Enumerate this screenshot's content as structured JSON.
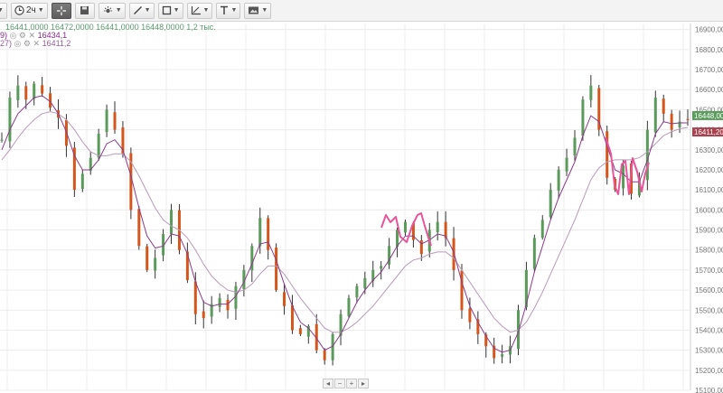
{
  "toolbar": {
    "interval_label": "2ч",
    "tools": [
      "menu",
      "interval",
      "crosshair",
      "save",
      "indicators",
      "draw-line",
      "draw-shape",
      "fibonacci",
      "text",
      "chart-type"
    ]
  },
  "legend": {
    "ohlc_text": "16441,0000   16472,0000   16441,0000   16448,0000   1,2 тыс.",
    "ma1_prefix": "9)",
    "ma1_value": "16434,1",
    "ma2_prefix": "27)",
    "ma2_value": "16411,2"
  },
  "nav": {
    "left": "◂",
    "minus": "−",
    "plus": "+",
    "right": "▸"
  },
  "colors": {
    "up": "#5a9a5a",
    "down": "#d5561a",
    "ma_fast": "#8a3c8a",
    "ma_slow": "#b89ab8",
    "annotation": "#e8559a",
    "badge_green": "#5b9b5b",
    "badge_red": "#a8424f"
  },
  "chart_data": {
    "type": "line",
    "title": "",
    "price_axis": "right",
    "ylim": [
      15100000,
      16930000
    ],
    "yticks": [
      15100000,
      15200000,
      15300000,
      15400000,
      15500000,
      15600000,
      15700000,
      15800000,
      15900000,
      16000000,
      16100000,
      16200000,
      16300000,
      16400000,
      16500000,
      16600000,
      16700000,
      16800000,
      16900000
    ],
    "ytick_labels": [
      "15100,000",
      "15200,000",
      "15300,000",
      "15400,000",
      "15500,000",
      "15600,000",
      "15700,000",
      "15800,000",
      "15900,000",
      "16000,000",
      "16100,000",
      "16200,000",
      "16300,000",
      "16400,000",
      "16500,000",
      "16600,000",
      "16700,000",
      "16800,000",
      "16900,000"
    ],
    "grid": true,
    "last_price_labels": [
      {
        "text": "16448,000",
        "value": 16448000,
        "color": "badge_green"
      },
      {
        "text": "16411,200",
        "value": 16411200,
        "color": "badge_red"
      }
    ],
    "series": [
      {
        "role": "price",
        "points": [
          16350,
          16560,
          16620,
          16550,
          16630,
          16580,
          16510,
          16460,
          16320,
          16100,
          16180,
          16260,
          16380,
          16500,
          16400,
          16280,
          16000,
          15820,
          15700,
          15760,
          15880,
          16000,
          15800,
          15650,
          15480,
          15460,
          15530,
          15560,
          15500,
          15620,
          15700,
          15820,
          15960,
          15800,
          15600,
          15520,
          15400,
          15380,
          15420,
          15300,
          15250,
          15380,
          15480,
          15560,
          15620,
          15660,
          15700,
          15720,
          15820,
          15900,
          15940,
          15850,
          15780,
          15900,
          15940,
          15860,
          15700,
          15500,
          15440,
          15380,
          15320,
          15260,
          15280,
          15320,
          15500,
          15700,
          15860,
          15950,
          16100,
          16200,
          16260,
          16360,
          16550,
          16620,
          16400,
          16160,
          16100,
          16220,
          16080,
          16160,
          16400,
          16560,
          16480,
          16400,
          16440,
          16448
        ]
      },
      {
        "role": "ma_fast",
        "points": [
          16300,
          16400,
          16480,
          16520,
          16560,
          16570,
          16540,
          16480,
          16390,
          16270,
          16200,
          16200,
          16250,
          16330,
          16350,
          16300,
          16170,
          16010,
          15870,
          15810,
          15820,
          15880,
          15870,
          15780,
          15640,
          15540,
          15520,
          15530,
          15530,
          15570,
          15640,
          15730,
          15830,
          15840,
          15750,
          15630,
          15520,
          15440,
          15410,
          15360,
          15300,
          15320,
          15380,
          15460,
          15540,
          15600,
          15650,
          15690,
          15750,
          15820,
          15870,
          15870,
          15830,
          15850,
          15880,
          15870,
          15790,
          15640,
          15520,
          15440,
          15370,
          15310,
          15290,
          15300,
          15390,
          15530,
          15690,
          15820,
          15950,
          16060,
          16150,
          16240,
          16370,
          16470,
          16440,
          16320,
          16200,
          16180,
          16140,
          16140,
          16250,
          16380,
          16440,
          16430,
          16434,
          16434
        ]
      },
      {
        "role": "ma_slow",
        "points": [
          16250,
          16300,
          16360,
          16410,
          16450,
          16480,
          16490,
          16480,
          16450,
          16400,
          16340,
          16290,
          16270,
          16270,
          16280,
          16280,
          16240,
          16170,
          16090,
          16010,
          15950,
          15920,
          15900,
          15860,
          15800,
          15730,
          15670,
          15630,
          15600,
          15590,
          15600,
          15630,
          15680,
          15720,
          15720,
          15680,
          15620,
          15560,
          15510,
          15460,
          15410,
          15390,
          15390,
          15410,
          15440,
          15480,
          15520,
          15570,
          15620,
          15670,
          15720,
          15750,
          15760,
          15780,
          15790,
          15790,
          15760,
          15700,
          15640,
          15580,
          15520,
          15460,
          15420,
          15390,
          15400,
          15440,
          15510,
          15590,
          15680,
          15770,
          15860,
          15950,
          16050,
          16150,
          16210,
          16240,
          16250,
          16250,
          16250,
          16260,
          16290,
          16330,
          16370,
          16390,
          16405,
          16411
        ]
      }
    ]
  }
}
